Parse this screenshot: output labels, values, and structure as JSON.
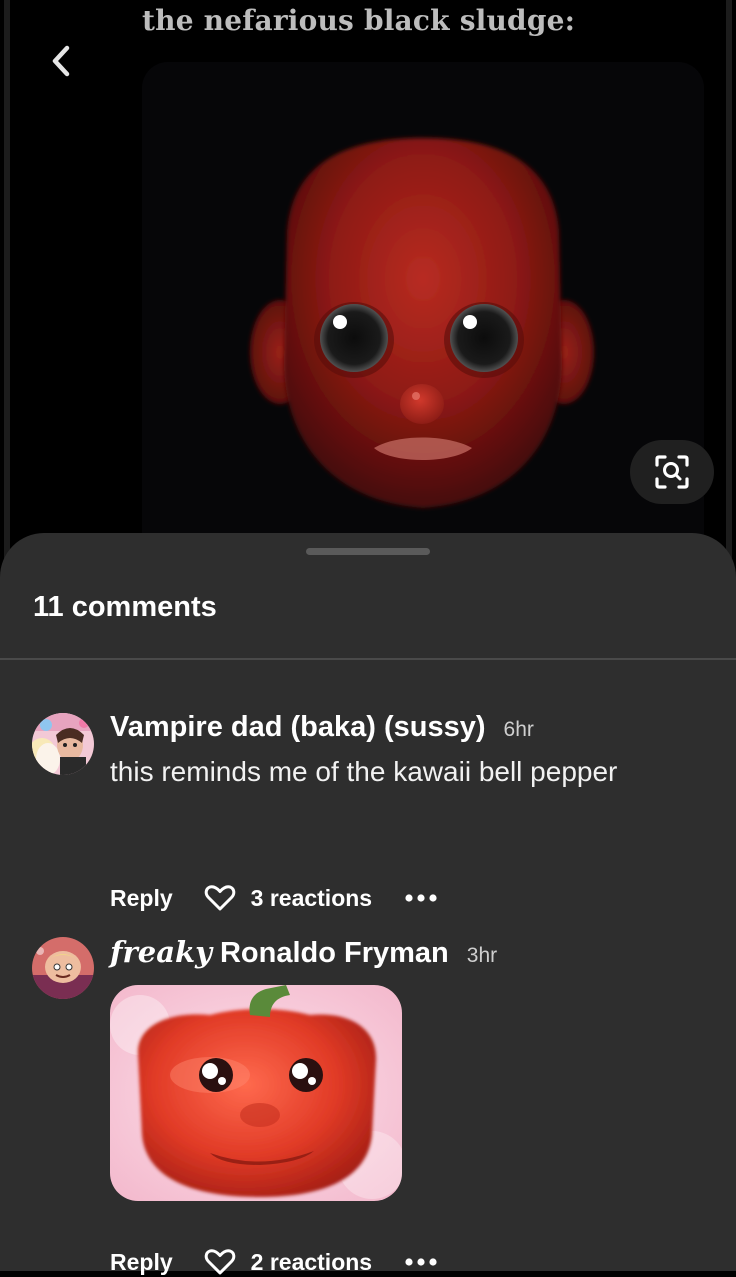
{
  "pin": {
    "title": "the nefarious black sludge:",
    "back_icon": "chevron-left-icon",
    "visual_search_icon": "visual-search-icon"
  },
  "comments_panel": {
    "count_label": "11 comments",
    "comments": [
      {
        "author": "Vampire dad (baka) (sussy)",
        "time": "6hr",
        "text": "this reminds me of the kawaii bell pepper",
        "reply_label": "Reply",
        "reactions_label": "3 reactions"
      },
      {
        "author_prefix": "freaky",
        "author": "Ronaldo Fryman",
        "time": "3hr",
        "reply_label": "Reply",
        "reactions_label": "2 reactions"
      }
    ]
  },
  "colors": {
    "sheet_background": "#2e2e2e",
    "page_background": "#000000",
    "text_primary": "#ffffff"
  }
}
